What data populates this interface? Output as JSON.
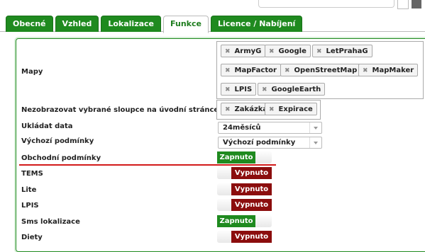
{
  "tabs": [
    {
      "label": "Obecné"
    },
    {
      "label": "Vzhled"
    },
    {
      "label": "Lokalizace"
    },
    {
      "label": "Funkce",
      "active": true
    },
    {
      "label": "Licence / Nabíjení"
    }
  ],
  "rows": {
    "mapy": {
      "label": "Mapy",
      "tags": [
        "ArmyG",
        "Google",
        "LetPrahaG",
        "MapFactor",
        "OpenStreetMap",
        "MapMaker",
        "LPIS",
        "GoogleEarth"
      ]
    },
    "sloupce": {
      "label": "Nezobrazovat vybrané sloupce na úvodní stránce",
      "tags": [
        "Zakázka",
        "Expirace"
      ]
    },
    "ukladat": {
      "label": "Ukládat data",
      "value": "24měsíců"
    },
    "vychozi": {
      "label": "Výchozí podmínky",
      "value": "Výchozí podmínky"
    },
    "obchodni": {
      "label": "Obchodní podmínky",
      "state": "Zapnuto"
    },
    "tems": {
      "label": "TEMS",
      "state": "Vypnuto"
    },
    "lite": {
      "label": "Lite",
      "state": "Vypnuto"
    },
    "lpis": {
      "label": "LPIS",
      "state": "Vypnuto"
    },
    "sms": {
      "label": "Sms lokalizace",
      "state": "Zapnuto"
    },
    "diety": {
      "label": "Diety",
      "state": "Vypnuto"
    }
  },
  "colors": {
    "on": "#1f8a1f",
    "off": "#8b0d0d",
    "highlight_line": "#d21a1a"
  },
  "icons": {
    "tag_remove": "close-icon",
    "dropdown": "chevron-down-icon"
  }
}
